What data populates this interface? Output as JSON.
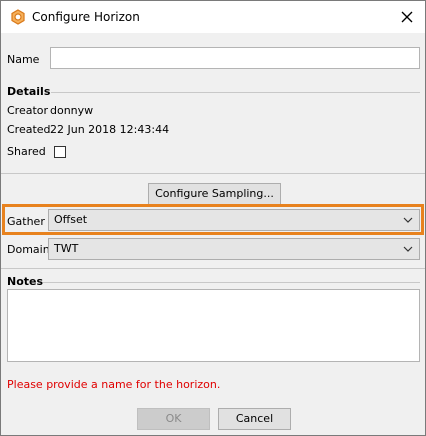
{
  "window": {
    "title": "Configure Horizon",
    "app_icon": "horizon-hexagon-icon",
    "close_icon": "close-icon"
  },
  "name_field": {
    "label": "Name",
    "value": ""
  },
  "details": {
    "heading": "Details",
    "creator_label": "Creator",
    "creator_value": "donnyw",
    "created_label": "Created",
    "created_value": "22 Jun 2018 12:43:44",
    "shared_label": "Shared",
    "shared_checked": false
  },
  "configure_sampling_button": "Configure Sampling...",
  "gather": {
    "label": "Gather",
    "selected": "Offset"
  },
  "domain": {
    "label": "Domain",
    "selected": "TWT"
  },
  "notes": {
    "heading": "Notes",
    "value": ""
  },
  "error_message": "Please provide a name for the horizon.",
  "buttons": {
    "ok": "OK",
    "cancel": "Cancel"
  },
  "colors": {
    "highlight": "#e8821e",
    "error": "#e00000",
    "icon": "#e8821e"
  }
}
